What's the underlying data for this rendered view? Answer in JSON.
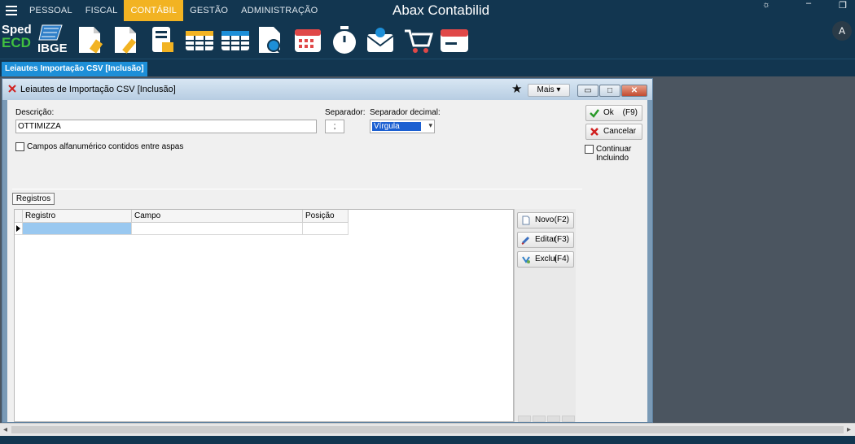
{
  "app": {
    "title": "Abax Contabilid",
    "menu": [
      "PESSOAL",
      "FISCAL",
      "CONTÁBIL",
      "GESTÃO",
      "ADMINISTRAÇÃO"
    ],
    "active_menu": "CONTÁBIL",
    "window_controls": {
      "settings": "☼",
      "minimize": "–",
      "restore": "❐"
    },
    "a_button": "A"
  },
  "toolbar": {
    "sped": {
      "line1": "Sped",
      "line2": "ECD"
    },
    "ibge": "IBGE",
    "icons": [
      "document-edit-icon",
      "document-pencil-icon",
      "calculator-doc-icon",
      "table-icon",
      "table-icon-2",
      "report-search-icon",
      "calendar-icon",
      "timer-icon",
      "mail-icon",
      "cart-icon",
      "wallet-icon"
    ]
  },
  "tab": {
    "label": "Leiautes Importação CSV [Inclusão]"
  },
  "dialog": {
    "title": "Leiautes de Importação CSV [Inclusão]",
    "mais_label": "Mais ▾",
    "window_buttons": {
      "minimize": "▭",
      "maximize": "□",
      "close": "✕"
    },
    "descricao_label": "Descrição:",
    "descricao_value": "OTTIMIZZA",
    "separador_label": "Separador:",
    "separador_value": ";",
    "separador_decimal_label": "Separador decimal:",
    "separador_decimal_value": "Vírgula",
    "campos_checkbox_label": "Campos alfanumérico contidos entre aspas",
    "ok_label": "Ok",
    "ok_key": "(F9)",
    "cancelar_label": "Cancelar",
    "continuar_label": "Continuar\nIncluindo",
    "registros_tab": "Registros",
    "grid": {
      "columns": [
        "Registro",
        "Campo",
        "Posição"
      ]
    },
    "novo_label": "Novo",
    "novo_key": "(F2)",
    "editar_label": "Editar",
    "editar_key": "(F3)",
    "excluir_label": "Exclui",
    "excluir_key": "(F4)"
  }
}
